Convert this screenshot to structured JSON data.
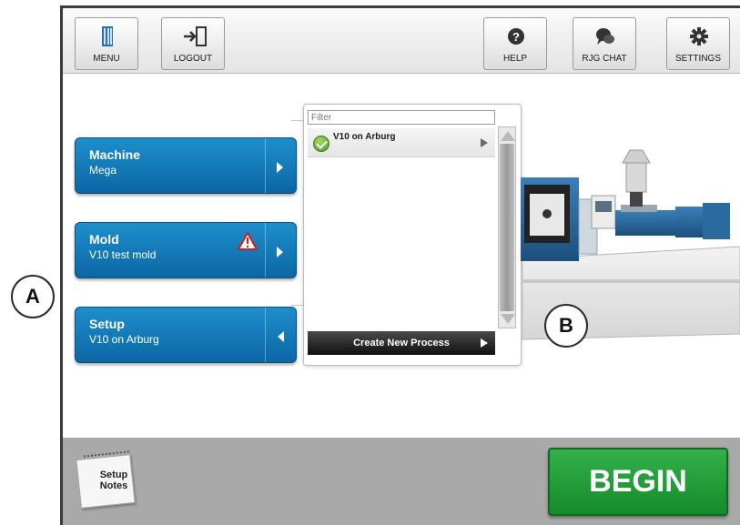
{
  "toolbar": {
    "menu_label": "MENU",
    "logout_label": "LOGOUT",
    "help_label": "HELP",
    "chat_label": "RJG CHAT",
    "settings_label": "SETTINGS"
  },
  "selectors": [
    {
      "title": "Machine",
      "value": "Mega",
      "arrow": "right"
    },
    {
      "title": "Mold",
      "value": "V10 test mold",
      "arrow": "right",
      "warning": true
    },
    {
      "title": "Setup",
      "value": "V10 on Arburg",
      "arrow": "left"
    }
  ],
  "process_panel": {
    "filter_placeholder": "Filter",
    "items": [
      {
        "name": "V10 on Arburg",
        "status_icon": "check-circle-icon"
      }
    ],
    "create_label": "Create New Process"
  },
  "callouts": {
    "a": "A",
    "b": "B"
  },
  "footer": {
    "notes_label_line1": "Setup",
    "notes_label_line2": "Notes",
    "begin_label": "BEGIN"
  },
  "colors": {
    "selector_blue": "#0b67a4",
    "begin_green": "#168b2c",
    "footer_gray": "#a9a9a9",
    "warning_red": "#d21f1f"
  }
}
